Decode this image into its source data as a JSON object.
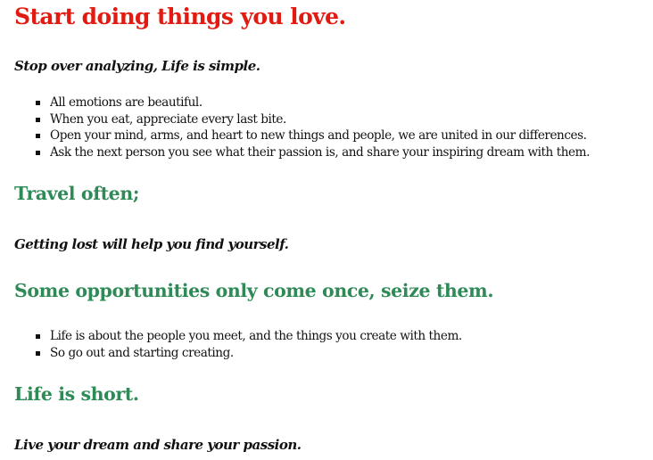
{
  "colors": {
    "title": "#e21b12",
    "heading": "#2f8a57",
    "text": "#111111",
    "background": "#ffffff"
  },
  "title": "Start doing things you love.",
  "subtitle": "Stop over analyzing, Life is simple.",
  "list_one": [
    "All emotions are beautiful.",
    "When you eat, appreciate every last bite.",
    "Open your mind, arms, and heart to new things and people, we are united in our differences.",
    "Ask the next person you see what their passion is, and share your inspiring dream with them."
  ],
  "section_travel": {
    "heading": "Travel often;",
    "quote": "Getting lost will help you find yourself."
  },
  "section_opportunities": {
    "heading": "Some opportunities only come once, seize them.",
    "items": [
      "Life is about the people you meet, and the things you create with them.",
      "So go out and starting creating."
    ]
  },
  "section_life": {
    "heading": "Life is short.",
    "quote": "Live your dream and share your passion."
  }
}
